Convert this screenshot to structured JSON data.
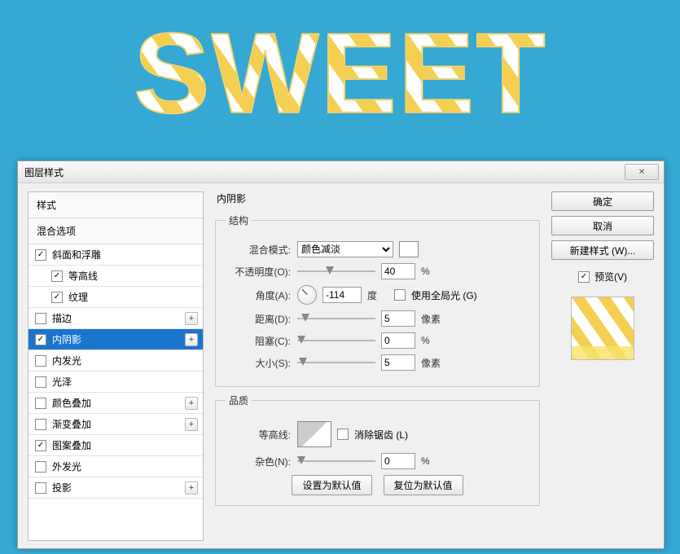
{
  "colors": {
    "bg": "#35a9d3",
    "candy_stripe": "#f5cf52"
  },
  "sweet_text": "SWEET",
  "dialog": {
    "title": "图层样式"
  },
  "sidebar": {
    "header_styles": "样式",
    "header_blend": "混合选项",
    "items": [
      {
        "label": "斜面和浮雕",
        "checked": true,
        "indent": false,
        "plus": false
      },
      {
        "label": "等高线",
        "checked": true,
        "indent": true,
        "plus": false
      },
      {
        "label": "纹理",
        "checked": true,
        "indent": true,
        "plus": false
      },
      {
        "label": "描边",
        "checked": false,
        "indent": false,
        "plus": true
      },
      {
        "label": "内阴影",
        "checked": true,
        "indent": false,
        "plus": true,
        "selected": true
      },
      {
        "label": "内发光",
        "checked": false,
        "indent": false,
        "plus": false
      },
      {
        "label": "光泽",
        "checked": false,
        "indent": false,
        "plus": false
      },
      {
        "label": "颜色叠加",
        "checked": false,
        "indent": false,
        "plus": true
      },
      {
        "label": "渐变叠加",
        "checked": false,
        "indent": false,
        "plus": true
      },
      {
        "label": "图案叠加",
        "checked": true,
        "indent": false,
        "plus": false
      },
      {
        "label": "外发光",
        "checked": false,
        "indent": false,
        "plus": false
      },
      {
        "label": "投影",
        "checked": false,
        "indent": false,
        "plus": true
      }
    ]
  },
  "settings": {
    "panel_title": "内阴影",
    "group_structure": "结构",
    "group_quality": "品质",
    "blend_mode_label": "混合模式:",
    "blend_mode_value": "颜色减淡",
    "opacity_label": "不透明度(O):",
    "opacity_value": "40",
    "opacity_unit": "%",
    "angle_label": "角度(A):",
    "angle_value": "-114",
    "angle_unit": "度",
    "use_global_light": "使用全局光 (G)",
    "distance_label": "距离(D):",
    "distance_value": "5",
    "distance_unit": "像素",
    "choke_label": "阻塞(C):",
    "choke_value": "0",
    "choke_unit": "%",
    "size_label": "大小(S):",
    "size_value": "5",
    "size_unit": "像素",
    "contour_label": "等高线:",
    "anti_alias": "消除锯齿 (L)",
    "noise_label": "杂色(N):",
    "noise_value": "0",
    "noise_unit": "%",
    "set_default": "设置为默认值",
    "reset_default": "复位为默认值"
  },
  "right": {
    "ok": "确定",
    "cancel": "取消",
    "new_style": "新建样式 (W)...",
    "preview": "预览(V)"
  }
}
